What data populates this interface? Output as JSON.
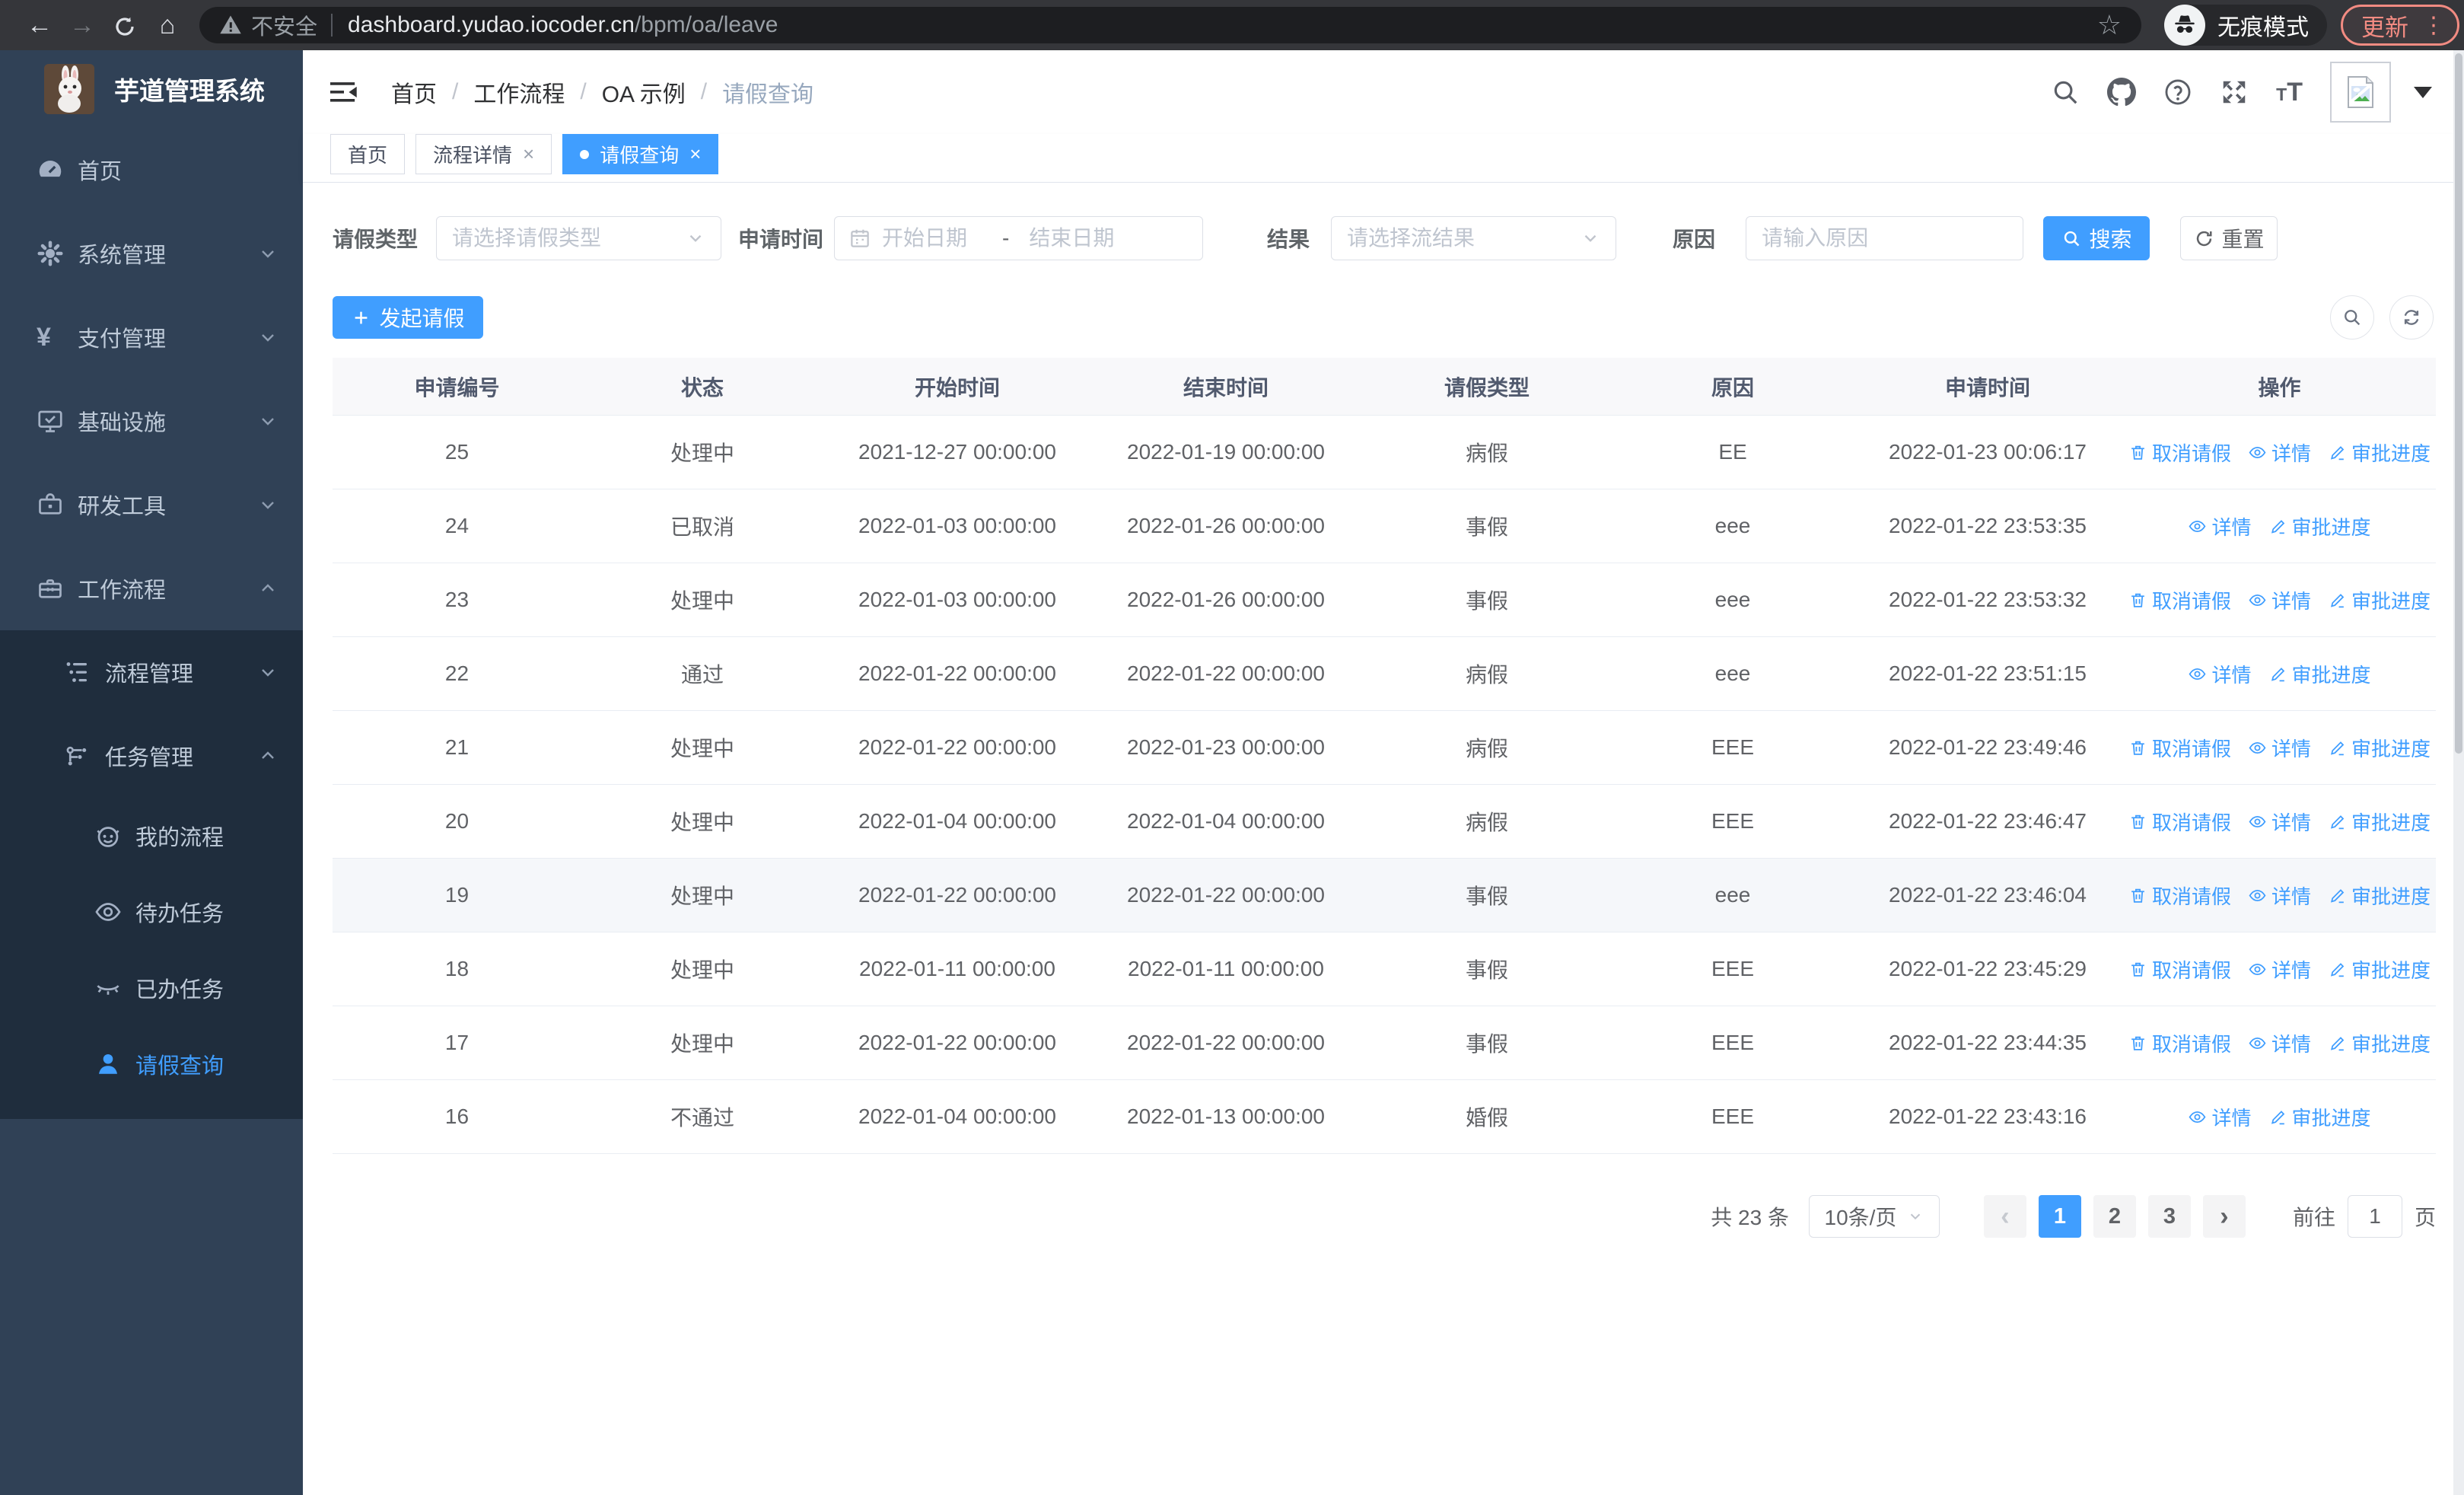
{
  "browser": {
    "security_label": "不安全",
    "url_host": "dashboard.yudao.iocoder.cn",
    "url_path": "/bpm/oa/leave",
    "incognito_label": "无痕模式",
    "update_label": "更新"
  },
  "sidebar": {
    "title": "芋道管理系统",
    "items": [
      {
        "label": "首页"
      },
      {
        "label": "系统管理"
      },
      {
        "label": "支付管理"
      },
      {
        "label": "基础设施"
      },
      {
        "label": "研发工具"
      },
      {
        "label": "工作流程"
      }
    ],
    "submenu": [
      {
        "label": "流程管理"
      },
      {
        "label": "任务管理"
      }
    ],
    "task_items": [
      {
        "label": "我的流程"
      },
      {
        "label": "待办任务"
      },
      {
        "label": "已办任务"
      },
      {
        "label": "请假查询"
      }
    ]
  },
  "header": {
    "breadcrumb": [
      "首页",
      "工作流程",
      "OA 示例",
      "请假查询"
    ]
  },
  "tabs": [
    {
      "label": "首页"
    },
    {
      "label": "流程详情"
    },
    {
      "label": "请假查询"
    }
  ],
  "filters": {
    "leave_type_label": "请假类型",
    "leave_type_placeholder": "请选择请假类型",
    "apply_time_label": "申请时间",
    "date_start_placeholder": "开始日期",
    "date_separator": "-",
    "date_end_placeholder": "结束日期",
    "result_label": "结果",
    "result_placeholder": "请选择流结果",
    "reason_label": "原因",
    "reason_placeholder": "请输入原因",
    "search_button": "搜索",
    "reset_button": "重置"
  },
  "toolbar": {
    "create_button": "发起请假"
  },
  "table": {
    "columns": [
      "申请编号",
      "状态",
      "开始时间",
      "结束时间",
      "请假类型",
      "原因",
      "申请时间",
      "操作"
    ],
    "rows": [
      {
        "id": "25",
        "status": "处理中",
        "start": "2021-12-27 00:00:00",
        "end": "2022-01-19 00:00:00",
        "type": "病假",
        "reason": "EE",
        "apply": "2022-01-23 00:06:17",
        "actions": [
          "取消请假",
          "详情",
          "审批进度"
        ]
      },
      {
        "id": "24",
        "status": "已取消",
        "start": "2022-01-03 00:00:00",
        "end": "2022-01-26 00:00:00",
        "type": "事假",
        "reason": "eee",
        "apply": "2022-01-22 23:53:35",
        "actions": [
          "详情",
          "审批进度"
        ]
      },
      {
        "id": "23",
        "status": "处理中",
        "start": "2022-01-03 00:00:00",
        "end": "2022-01-26 00:00:00",
        "type": "事假",
        "reason": "eee",
        "apply": "2022-01-22 23:53:32",
        "actions": [
          "取消请假",
          "详情",
          "审批进度"
        ]
      },
      {
        "id": "22",
        "status": "通过",
        "start": "2022-01-22 00:00:00",
        "end": "2022-01-22 00:00:00",
        "type": "病假",
        "reason": "eee",
        "apply": "2022-01-22 23:51:15",
        "actions": [
          "详情",
          "审批进度"
        ]
      },
      {
        "id": "21",
        "status": "处理中",
        "start": "2022-01-22 00:00:00",
        "end": "2022-01-23 00:00:00",
        "type": "病假",
        "reason": "EEE",
        "apply": "2022-01-22 23:49:46",
        "actions": [
          "取消请假",
          "详情",
          "审批进度"
        ]
      },
      {
        "id": "20",
        "status": "处理中",
        "start": "2022-01-04 00:00:00",
        "end": "2022-01-04 00:00:00",
        "type": "病假",
        "reason": "EEE",
        "apply": "2022-01-22 23:46:47",
        "actions": [
          "取消请假",
          "详情",
          "审批进度"
        ]
      },
      {
        "id": "19",
        "status": "处理中",
        "start": "2022-01-22 00:00:00",
        "end": "2022-01-22 00:00:00",
        "type": "事假",
        "reason": "eee",
        "apply": "2022-01-22 23:46:04",
        "actions": [
          "取消请假",
          "详情",
          "审批进度"
        ]
      },
      {
        "id": "18",
        "status": "处理中",
        "start": "2022-01-11 00:00:00",
        "end": "2022-01-11 00:00:00",
        "type": "事假",
        "reason": "EEE",
        "apply": "2022-01-22 23:45:29",
        "actions": [
          "取消请假",
          "详情",
          "审批进度"
        ]
      },
      {
        "id": "17",
        "status": "处理中",
        "start": "2022-01-22 00:00:00",
        "end": "2022-01-22 00:00:00",
        "type": "事假",
        "reason": "EEE",
        "apply": "2022-01-22 23:44:35",
        "actions": [
          "取消请假",
          "详情",
          "审批进度"
        ]
      },
      {
        "id": "16",
        "status": "不通过",
        "start": "2022-01-04 00:00:00",
        "end": "2022-01-13 00:00:00",
        "type": "婚假",
        "reason": "EEE",
        "apply": "2022-01-22 23:43:16",
        "actions": [
          "详情",
          "审批进度"
        ]
      }
    ]
  },
  "pagination": {
    "total_text": "共 23 条",
    "page_size": "10条/页",
    "pages": [
      "1",
      "2",
      "3"
    ],
    "goto_label": "前往",
    "goto_value": "1",
    "page_unit": "页"
  },
  "colors": {
    "primary": "#409EFF",
    "sidebar_bg": "#304156",
    "submenu_bg": "#1f2d3d",
    "update_accent": "#f28b82"
  }
}
